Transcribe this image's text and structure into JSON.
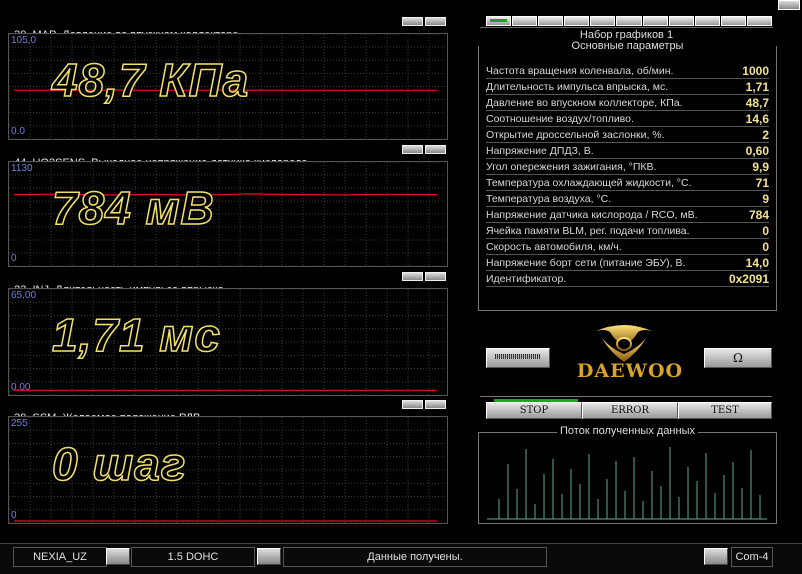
{
  "charts": [
    {
      "id": "30",
      "code": "MAP",
      "desc": "Давление во впускном коллекторе.",
      "max": "105,0",
      "min": "0.0",
      "big": "48,7 КПа"
    },
    {
      "id": "44",
      "code": "UO2SENS",
      "desc": "Выходное напряжение датчика кислорода.",
      "max": "1130",
      "min": "0",
      "big": "784 мВ"
    },
    {
      "id": "23",
      "code": "INJ",
      "desc": "Длительность импульса впрыска.",
      "max": "65,00",
      "min": "0.00",
      "big": "1,71 мс"
    },
    {
      "id": "39",
      "code": "SSM",
      "desc": "Желаемое положение РДВ.",
      "max": "255",
      "min": "0",
      "big": "0 шаг"
    }
  ],
  "chart_data": [
    {
      "type": "line",
      "series": [
        {
          "values": [
            48.7,
            48.7,
            48.9,
            48.6,
            48.7,
            48.8,
            48.7,
            48.6,
            48.7,
            48.7
          ]
        }
      ],
      "ylim": [
        0,
        105
      ]
    },
    {
      "type": "line",
      "series": [
        {
          "values": [
            784,
            790,
            780,
            786,
            778,
            792,
            784,
            781,
            788,
            784
          ]
        }
      ],
      "ylim": [
        0,
        1130
      ]
    },
    {
      "type": "line",
      "series": [
        {
          "values": [
            1.71,
            1.71,
            1.71,
            1.71,
            1.71,
            1.71,
            1.71,
            1.71,
            1.71,
            1.71
          ]
        }
      ],
      "ylim": [
        0,
        65
      ]
    },
    {
      "type": "line",
      "series": [
        {
          "values": [
            0,
            0,
            0,
            0,
            0,
            0,
            0,
            0,
            0,
            0
          ]
        }
      ],
      "ylim": [
        0,
        255
      ]
    }
  ],
  "graph_set": "Набор графиков 1",
  "params_title": "Основные параметры",
  "params": [
    {
      "label": "Частота вращения коленвала, об/мин.",
      "value": "1000"
    },
    {
      "label": "Длительность импульса впрыска, мс.",
      "value": "1,71"
    },
    {
      "label": "Давление во впускном коллекторе, КПа.",
      "value": "48,7"
    },
    {
      "label": "Соотношение воздух/топливо.",
      "value": "14,6"
    },
    {
      "label": "Открытие дроссельной заслонки, %.",
      "value": "2"
    },
    {
      "label": "Напряжение ДПДЗ, В.",
      "value": "0,60"
    },
    {
      "label": "Угол опережения зажигания, °ПКВ.",
      "value": "9,9"
    },
    {
      "label": "Температура охлаждающей жидкости, °С.",
      "value": "71"
    },
    {
      "label": "Температура воздуха, °С.",
      "value": "9"
    },
    {
      "label": "Напряжение датчика кислорода / RCO, мВ.",
      "value": "784"
    },
    {
      "label": "Ячейка памяти BLM, рег. подачи топлива.",
      "value": "0"
    },
    {
      "label": "Скорость автомобиля, км/ч.",
      "value": "0"
    },
    {
      "label": "Напряжение борт сети (питание ЭБУ), В.",
      "value": "14,0"
    },
    {
      "label": "Идентификатор.",
      "value": "0x2091"
    }
  ],
  "brand": "DAEWOO",
  "buttons": {
    "stop": "STOP",
    "error": "ERROR",
    "test": "TEST",
    "right_icon": "Ω"
  },
  "stream_title": "Поток полученных данных",
  "status": {
    "car": "NEXIA_UZ",
    "engine": "1.5 DOHC",
    "message": "Данные получены.",
    "port": "Com-4"
  },
  "colors": {
    "trace": "#e0102a",
    "value": "#f5e38a",
    "big_text_outline": "#f0e06a"
  }
}
